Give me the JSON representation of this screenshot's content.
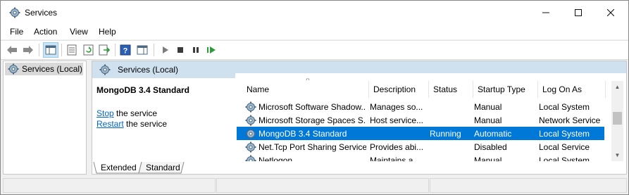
{
  "window": {
    "title": "Services",
    "icon": "services-gear-icon"
  },
  "menu": [
    "File",
    "Action",
    "View",
    "Help"
  ],
  "toolbar": {
    "buttons": [
      "back-icon",
      "forward-icon",
      "show-console-tree-icon",
      "properties-icon",
      "refresh-icon",
      "export-list-icon",
      "help-icon",
      "show-action-pane-icon",
      "start-service-icon",
      "stop-service-icon",
      "pause-service-icon",
      "resume-service-icon"
    ]
  },
  "tree": {
    "item": "Services (Local)"
  },
  "pane": {
    "header": "Services (Local)",
    "selected_service": "MongoDB 3.4 Standard",
    "stop_link": "Stop",
    "stop_rest": " the service",
    "restart_link": "Restart",
    "restart_rest": " the service"
  },
  "columns": {
    "name": "Name",
    "description": "Description",
    "status": "Status",
    "startup": "Startup Type",
    "logon": "Log On As"
  },
  "services": [
    {
      "name": "Microsoft Software Shadow...",
      "description": "Manages so...",
      "status": "",
      "startup": "Manual",
      "logon": "Local System"
    },
    {
      "name": "Microsoft Storage Spaces S...",
      "description": "Host service...",
      "status": "",
      "startup": "Manual",
      "logon": "Network Service"
    },
    {
      "name": "MongoDB 3.4 Standard",
      "description": "",
      "status": "Running",
      "startup": "Automatic",
      "logon": "Local System",
      "selected": true
    },
    {
      "name": "Net.Tcp Port Sharing Service",
      "description": "Provides abi...",
      "status": "",
      "startup": "Disabled",
      "logon": "Local Service"
    },
    {
      "name": "Netlogon",
      "description": "Maintains a ...",
      "status": "",
      "startup": "Manual",
      "logon": "Local System"
    }
  ],
  "tabs": [
    "Extended",
    "Standard"
  ],
  "colors": {
    "selection": "#0078d7",
    "pane_header": "#cfe0ee",
    "link": "#0066cc"
  }
}
